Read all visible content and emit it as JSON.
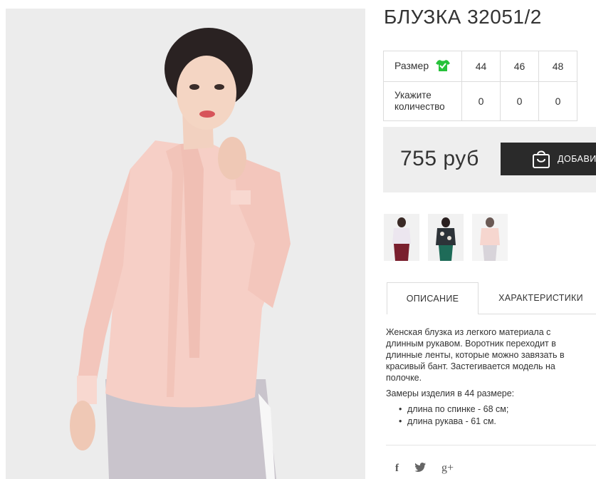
{
  "product": {
    "title": "БЛУЗКА 32051/2",
    "price": "755 руб",
    "add_button_label": "ДОБАВИТЬ"
  },
  "size_table": {
    "size_label": "Размер",
    "quantity_label_line1": "Укажите",
    "quantity_label_line2": "количество",
    "sizes": [
      "44",
      "46",
      "48"
    ],
    "quantities": [
      "0",
      "0",
      "0"
    ]
  },
  "tabs": {
    "description": "ОПИСАНИЕ",
    "characteristics": "ХАРАКТЕРИСТИКИ"
  },
  "description": {
    "text": "Женская блузка из легкого материала с длинным рукавом. Воротник переходит в длинные ленты, которые можно завязать в красивый бант. Застегивается модель на полочке.",
    "measurements_title": "Замеры изделия в 44 размере:",
    "measurements": [
      "длина по спинке - 68 см;",
      "длина рукава - 61 см."
    ]
  },
  "social": {
    "icons": [
      "facebook-icon",
      "twitter-icon",
      "google-plus-icon"
    ],
    "facebook": "f",
    "google_plus": "g+"
  },
  "colors": {
    "button_bg": "#2a2a2a",
    "price_box_bg": "#eeeeee",
    "size_icon": "#27c23a",
    "blouse": "#f6cfc6"
  }
}
